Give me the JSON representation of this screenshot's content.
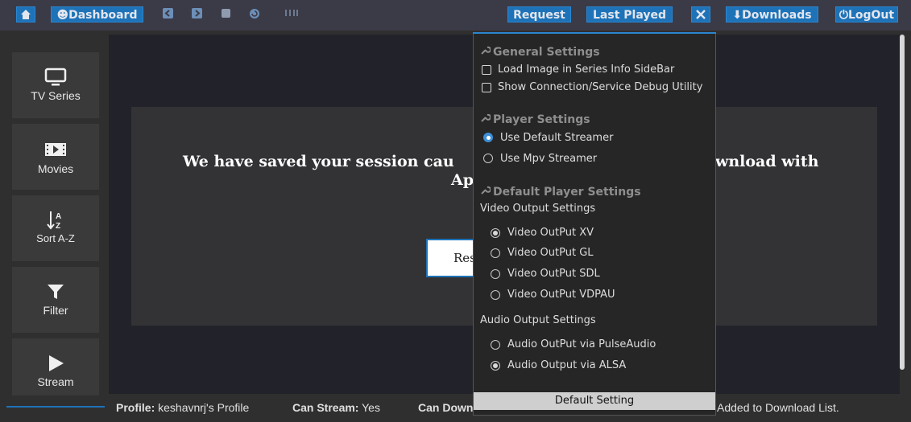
{
  "topbar": {
    "dashboard_label": "☻Dashboard",
    "request_label": "Request",
    "last_played_label": "Last Played",
    "downloads_label": "⬇Downloads",
    "logout_label": "⏻LogOut",
    "icons": [
      "home-icon",
      "back-icon",
      "forward-icon",
      "stop-icon",
      "refresh-icon",
      "grid-icon",
      "tools-icon"
    ]
  },
  "sidebar": {
    "items": [
      {
        "label": "TV Series",
        "icon": "monitor-icon"
      },
      {
        "label": "Movies",
        "icon": "film-icon"
      },
      {
        "label": "Sort A-Z",
        "icon": "sort-az-icon"
      },
      {
        "label": "Filter",
        "icon": "filter-icon"
      },
      {
        "label": "Stream",
        "icon": "play-icon"
      }
    ]
  },
  "main": {
    "message_line1": "We have saved your session cau",
    "message_line1_tail": "wnload with",
    "message_line2": "Ap",
    "button_label": "Res"
  },
  "status": {
    "profile_label": "Profile:",
    "profile_value": "keshavnrj's Profile",
    "can_stream_label": "Can Stream:",
    "can_stream_value": "Yes",
    "can_down_label": "Can Down",
    "added_text": "Added to Download List."
  },
  "popup": {
    "general_title": "General Settings",
    "load_image": "Load Image in Series Info SideBar",
    "show_debug": "Show Connection/Service Debug Utility",
    "player_title": "Player Settings",
    "use_default": "Use Default Streamer",
    "use_mpv": "Use Mpv Streamer",
    "default_player_title": "Default Player Settings",
    "video_output_settings": "Video Output Settings",
    "video_xv": "Video OutPut XV",
    "video_gl": "Video OutPut GL",
    "video_sdl": "Video OutPut SDL",
    "video_vdpau": "Video OutPut VDPAU",
    "audio_output_settings": "Audio Output Settings",
    "audio_pulse": "Audio OutPut via PulseAudio",
    "audio_alsa": "Audio Output via ALSA",
    "default_setting": "Default Setting"
  },
  "colors": {
    "accent": "#1e73b8",
    "topbar": "#3b3a47",
    "popup_bg": "#262626"
  }
}
